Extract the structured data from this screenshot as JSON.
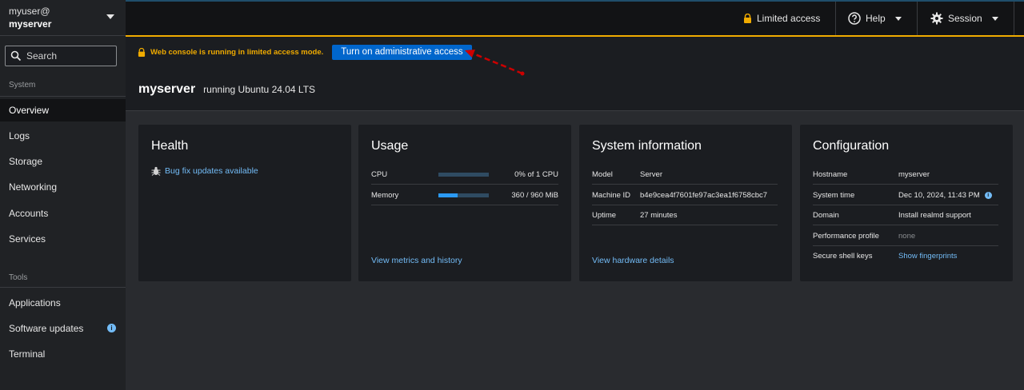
{
  "sidebar": {
    "host_user": "myuser@",
    "host_name": "myserver",
    "search_placeholder": "Search",
    "system_label": "System",
    "tools_label": "Tools",
    "items": [
      {
        "label": "Overview"
      },
      {
        "label": "Logs"
      },
      {
        "label": "Storage"
      },
      {
        "label": "Networking"
      },
      {
        "label": "Accounts"
      },
      {
        "label": "Services"
      }
    ],
    "tools": [
      {
        "label": "Applications"
      },
      {
        "label": "Software updates"
      },
      {
        "label": "Terminal"
      }
    ],
    "active_item": "Overview",
    "badge_icon": "info-icon"
  },
  "topbar": {
    "limited_access": "Limited access",
    "help": "Help",
    "session": "Session"
  },
  "alert": {
    "text": "Web console is running in limited access mode.",
    "button": "Turn on administrative access",
    "annotation": "red-dashed-arrow"
  },
  "page": {
    "server_name": "myserver",
    "os": "running Ubuntu 24.04 LTS"
  },
  "health": {
    "title": "Health",
    "updates_link": "Bug fix updates available",
    "icon": "bug-icon"
  },
  "usage": {
    "title": "Usage",
    "cpu_label": "CPU",
    "cpu_value": "0% of 1 CPU",
    "cpu_fraction": 0.0,
    "memory_label": "Memory",
    "memory_value": "360 / 960 MiB",
    "memory_fraction": 0.375,
    "link": "View metrics and history"
  },
  "sysinfo": {
    "title": "System information",
    "rows": [
      {
        "label": "Model",
        "value": "Server"
      },
      {
        "label": "Machine ID",
        "value": "b4e9cea4f7601fe97ac3ea1f6758cbc7"
      },
      {
        "label": "Uptime",
        "value": "27 minutes"
      }
    ],
    "link": "View hardware details"
  },
  "config": {
    "title": "Configuration",
    "hostname_label": "Hostname",
    "hostname_value": "myserver",
    "time_label": "System time",
    "time_value": "Dec 10, 2024, 11:43 PM",
    "domain_label": "Domain",
    "domain_value": "Install realmd support",
    "perf_label": "Performance profile",
    "perf_value": "none",
    "ssh_label": "Secure shell keys",
    "ssh_value": "Show fingerprints"
  },
  "colors": {
    "accent": "#0066cc",
    "link": "#73bcf7",
    "warning": "#f0ab00",
    "annotation": "#cc0000"
  }
}
